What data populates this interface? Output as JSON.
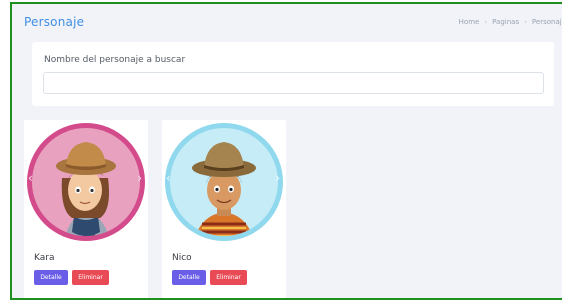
{
  "page": {
    "title": "Personaje",
    "breadcrumb": [
      "Home",
      "Paginas",
      "Personaje"
    ]
  },
  "search": {
    "label": "Nombre del personaje a buscar",
    "value": "",
    "placeholder": ""
  },
  "characters": [
    {
      "name": "Kara",
      "detail_label": "Detalle",
      "delete_label": "Eliminar",
      "ring_color": "#d44b8c",
      "bg_color": "#e8a2bf"
    },
    {
      "name": "Nico",
      "detail_label": "Detalle",
      "delete_label": "Eliminar",
      "ring_color": "#8fd8ee",
      "bg_color": "#c5ecf7"
    }
  ],
  "icons": {
    "prev": "chevron-left-icon",
    "next": "chevron-right-icon"
  },
  "colors": {
    "accent": "#3f8fe6",
    "detail_button": "#6a5ee8",
    "delete_button": "#e84b55"
  }
}
